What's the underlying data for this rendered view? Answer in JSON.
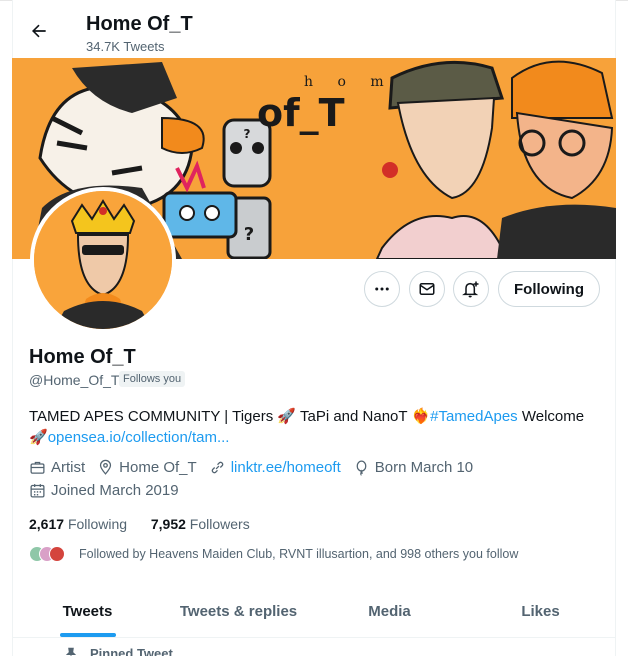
{
  "header": {
    "name": "Home Of_T",
    "tweet_count": "34.7K Tweets"
  },
  "banner": {
    "logo_top": "h o m e",
    "logo_main": "of_T"
  },
  "actions": {
    "follow_label": "Following"
  },
  "profile": {
    "name": "Home Of_T",
    "handle": "@Home_Of_T",
    "follows_you": "Follows you",
    "bio_part1": "TAMED APES COMMUNITY | Tigers ",
    "bio_part2": " TaPi and NanoT ",
    "bio_hashtag": "#TamedApes",
    "bio_part3": " Welcome",
    "bio_link": "opensea.io/collection/tam...",
    "category": "Artist",
    "location": "Home Of_T",
    "website": "linktr.ee/homeoft",
    "birthday": "Born March 10",
    "joined": "Joined March 2019",
    "following_count": "2,617",
    "following_label": "Following",
    "followers_count": "7,952",
    "followers_label": "Followers",
    "followed_by": "Followed by Heavens Maiden Club, RVNT illusartion, and 998 others you follow"
  },
  "tabs": [
    {
      "label": "Tweets",
      "active": true
    },
    {
      "label": "Tweets & replies",
      "active": false
    },
    {
      "label": "Media",
      "active": false
    },
    {
      "label": "Likes",
      "active": false
    }
  ],
  "pinned_label": "Pinned Tweet",
  "colors": {
    "accent": "#1d9bf0",
    "banner": "#f7a23a"
  }
}
